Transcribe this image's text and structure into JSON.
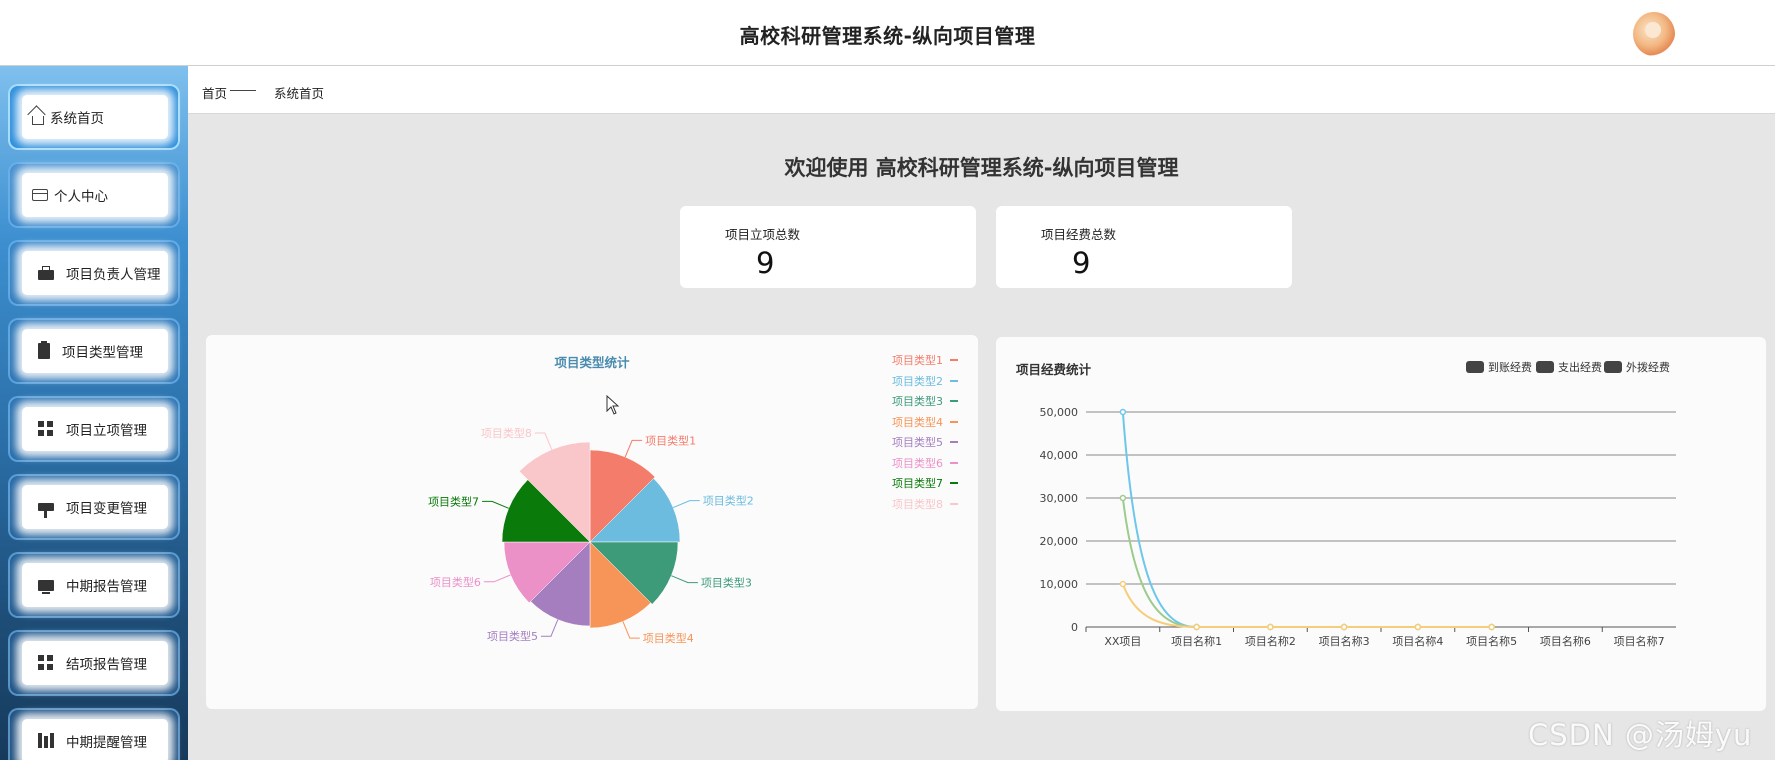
{
  "header": {
    "title": "高校科研管理系统-纵向项目管理"
  },
  "sidebar": {
    "items": [
      {
        "label": "系统首页",
        "icon": "home-icon"
      },
      {
        "label": "个人中心",
        "icon": "card-icon"
      },
      {
        "label": "项目负责人管理",
        "icon": "briefcase-icon"
      },
      {
        "label": "项目类型管理",
        "icon": "clipboard-icon"
      },
      {
        "label": "项目立项管理",
        "icon": "grid-icon"
      },
      {
        "label": "项目变更管理",
        "icon": "pin-icon"
      },
      {
        "label": "中期报告管理",
        "icon": "monitor-icon"
      },
      {
        "label": "结项报告管理",
        "icon": "grid-icon"
      },
      {
        "label": "中期提醒管理",
        "icon": "books-icon"
      }
    ]
  },
  "breadcrumb": {
    "home": "首页",
    "current": "系统首页"
  },
  "welcome": "欢迎使用 高校科研管理系统-纵向项目管理",
  "stats": [
    {
      "label": "项目立项总数",
      "value": "9"
    },
    {
      "label": "项目经费总数",
      "value": "9"
    }
  ],
  "chart_data": [
    {
      "type": "pie",
      "title": "项目类型统计",
      "categories": [
        "项目类型1",
        "项目类型2",
        "项目类型3",
        "项目类型4",
        "项目类型5",
        "项目类型6",
        "项目类型7",
        "项目类型8"
      ],
      "values": [
        1,
        1,
        1,
        1,
        1,
        1,
        1,
        1
      ],
      "colors": [
        "#f47c6a",
        "#6bbcdf",
        "#3d9b7a",
        "#f79457",
        "#a57ec0",
        "#ec90c8",
        "#0a7a0a",
        "#f9c6ca"
      ],
      "legend": "top-right"
    },
    {
      "type": "line",
      "title": "项目经费统计",
      "categories": [
        "XX项目",
        "项目名称1",
        "项目名称2",
        "项目名称3",
        "项目名称4",
        "项目名称5",
        "项目名称6",
        "项目名称7"
      ],
      "series": [
        {
          "name": "到账经费",
          "values": [
            50000,
            0,
            0,
            0,
            0,
            0
          ],
          "color": "#6ec7ea"
        },
        {
          "name": "支出经费",
          "values": [
            30000,
            0,
            0,
            0,
            0,
            0
          ],
          "color": "#9ccb8c"
        },
        {
          "name": "外拨经费",
          "values": [
            10000,
            0,
            0,
            0,
            0,
            0
          ],
          "color": "#f6cd7a"
        }
      ],
      "y_ticks": [
        "0",
        "10,000",
        "20,000",
        "30,000",
        "40,000",
        "50,000"
      ],
      "ylim": [
        0,
        50000
      ],
      "grid": true,
      "legend": "top-right"
    }
  ],
  "watermark": "CSDN @汤姆yu"
}
